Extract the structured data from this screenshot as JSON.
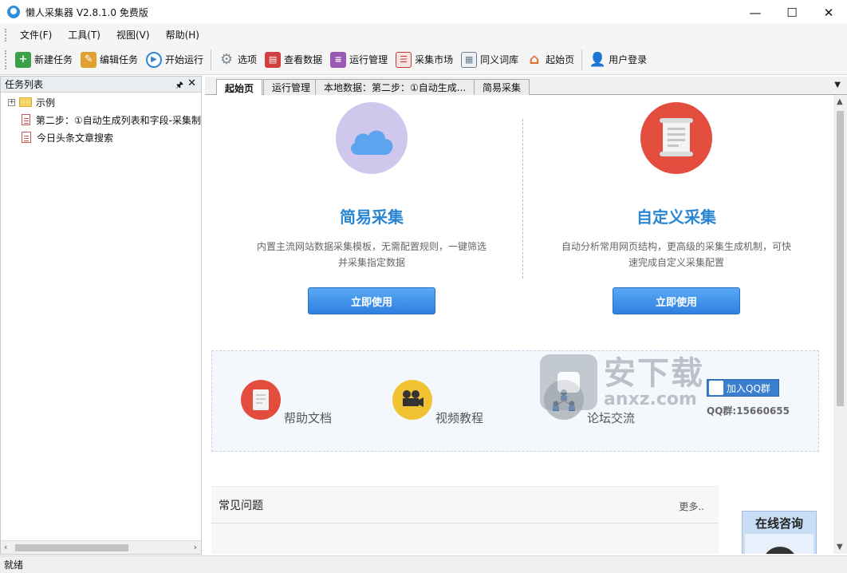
{
  "window": {
    "title": "懒人采集器 V2.8.1.0 免费版",
    "minimize": "—",
    "maximize": "☐",
    "close": "✕"
  },
  "menu": {
    "items": [
      "文件(F)",
      "工具(T)",
      "视图(V)",
      "帮助(H)"
    ]
  },
  "toolbar": {
    "items": [
      {
        "label": "新建任务",
        "icon": "new-task-icon",
        "color": "#3aa04a"
      },
      {
        "label": "编辑任务",
        "icon": "edit-task-icon",
        "color": "#e0a030"
      },
      {
        "label": "开始运行",
        "icon": "play-icon",
        "color": "#2f86d6"
      },
      {
        "label": "选项",
        "icon": "gear-icon",
        "color": "#7b8790"
      },
      {
        "label": "查看数据",
        "icon": "data-icon",
        "color": "#d04040"
      },
      {
        "label": "运行管理",
        "icon": "database-icon",
        "color": "#9b59b6"
      },
      {
        "label": "采集市场",
        "icon": "market-icon",
        "color": "#c0392b"
      },
      {
        "label": "同义词库",
        "icon": "document-icon",
        "color": "#6b7b8c"
      },
      {
        "label": "起始页",
        "icon": "home-icon",
        "color": "#e07030"
      },
      {
        "label": "用户登录",
        "icon": "user-icon",
        "color": "#3f88c5"
      }
    ]
  },
  "task_panel": {
    "title": "任务列表",
    "pin": "🖈",
    "close": "✕",
    "tree": [
      {
        "label": "示例",
        "type": "folder",
        "expander": "+"
      },
      {
        "label": "第二步：①自动生成列表和字段-采集制",
        "type": "task"
      },
      {
        "label": "今日头条文章搜索",
        "type": "task"
      }
    ]
  },
  "tabs": [
    {
      "label": "起始页",
      "active": true
    },
    {
      "label": "运行管理",
      "active": false
    },
    {
      "label": "本地数据：第二步：①自动生成...",
      "active": false
    },
    {
      "label": "简易采集",
      "active": false
    }
  ],
  "start_page": {
    "simple": {
      "title": "简易采集",
      "desc": "内置主流网站数据采集模板，无需配置规则，一键筛选并采集指定数据",
      "button": "立即使用",
      "icon": "cloud-icon",
      "circle_color": "#cfc7ec",
      "icon_color": "#5ea3ee"
    },
    "custom": {
      "title": "自定义采集",
      "desc": "自动分析常用网页结构，更高级的采集生成机制，可快速完成自定义采集配置",
      "button": "立即使用",
      "icon": "scroll-icon",
      "circle_color": "#e24d3d"
    },
    "resources": [
      {
        "label": "帮助文档",
        "icon": "help-doc-icon",
        "color": "#e24d3d"
      },
      {
        "label": "视频教程",
        "icon": "video-camera-icon",
        "color": "#f1c232"
      },
      {
        "label": "论坛交流",
        "icon": "forum-icon",
        "color": "#b9bec4"
      }
    ],
    "qq": {
      "button": "加入QQ群",
      "number": "QQ群:15660655"
    },
    "faq": {
      "title": "常见问题",
      "more": "更多.."
    },
    "consult": {
      "title": "在线咨询"
    },
    "watermark": {
      "cn": "安下载",
      "en": "anxz.com"
    }
  },
  "status": {
    "text": "就绪"
  }
}
